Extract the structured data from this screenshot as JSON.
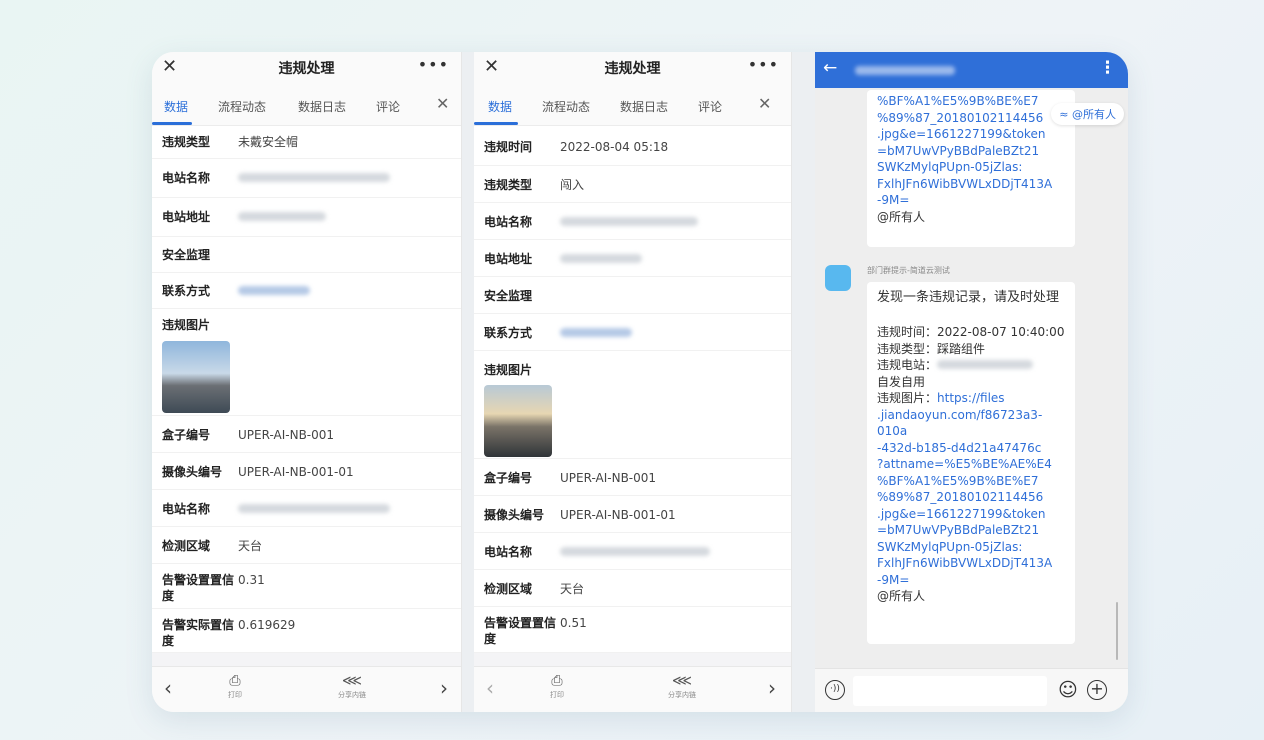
{
  "app": {
    "title": "违规处理",
    "close_glyph": "✕",
    "more_glyph": "•••",
    "tabs": [
      "数据",
      "流程动态",
      "数据日志",
      "评论"
    ],
    "tab_close_glyph": "✕"
  },
  "panel1": {
    "rows": [
      {
        "label": "违规类型",
        "value": "未戴安全帽"
      },
      {
        "label": "电站名称",
        "value": ""
      },
      {
        "label": "电站地址",
        "value": ""
      },
      {
        "label": "安全监理",
        "value": ""
      },
      {
        "label": "联系方式",
        "value": ""
      },
      {
        "label": "违规图片",
        "value": ""
      },
      {
        "label": "盒子编号",
        "value": "UPER-AI-NB-001"
      },
      {
        "label": "摄像头编号",
        "value": "UPER-AI-NB-001-01"
      },
      {
        "label": "电站名称",
        "value": ""
      },
      {
        "label": "检测区域",
        "value": "天台"
      },
      {
        "label": "告警设置置信度",
        "value": "0.31"
      },
      {
        "label": "告警实际置信度",
        "value": "0.619629"
      }
    ]
  },
  "panel2": {
    "rows": [
      {
        "label": "违规时间",
        "value": "2022-08-04 05:18"
      },
      {
        "label": "违规类型",
        "value": "闯入"
      },
      {
        "label": "电站名称",
        "value": ""
      },
      {
        "label": "电站地址",
        "value": ""
      },
      {
        "label": "安全监理",
        "value": ""
      },
      {
        "label": "联系方式",
        "value": ""
      },
      {
        "label": "违规图片",
        "value": ""
      },
      {
        "label": "盒子编号",
        "value": "UPER-AI-NB-001"
      },
      {
        "label": "摄像头编号",
        "value": "UPER-AI-NB-001-01"
      },
      {
        "label": "电站名称",
        "value": ""
      },
      {
        "label": "检测区域",
        "value": "天台"
      },
      {
        "label": "告警设置置信度",
        "value": "0.51"
      }
    ]
  },
  "bottom_bar": {
    "prev_glyph": "‹",
    "next_glyph": "›",
    "print_label": "打印",
    "share_label": "分享内链"
  },
  "chat": {
    "back_glyph": "←",
    "menu_glyph": "⋮",
    "mention_tag": "≈ @所有人",
    "msg1_lines": [
      "%BF%A1%E5%9B%BE%E7",
      "%89%87_20180102114456",
      ".jpg&e=1661227199&token",
      "=bM7UwVPyBBdPaleBZt21",
      "SWKzMylqPUpn-05jZlas:",
      "FxlhJFn6WibBVWLxDDjT413A",
      "-9M="
    ],
    "msg1_mention": "@所有人",
    "bot_name": "部门群提示-简道云测试",
    "msg2_intro": "发现一条违规记录，请及时处理",
    "msg2_time": "违规时间：2022-08-07 10:40:00",
    "msg2_type": "违规类型：踩踏组件",
    "msg2_station_label": "违规电站：",
    "msg2_station_extra": "自发自用",
    "msg2_img_label": "违规图片：",
    "msg2_link_lines": [
      "https://files",
      ".jiandaoyun.com/f86723a3-010a",
      "-432d-b185-d4d21a47476c",
      "?attname=%E5%BE%AE%E4",
      "%BF%A1%E5%9B%BE%E7",
      "%89%87_20180102114456",
      ".jpg&e=1661227199&token",
      "=bM7UwVPyBBdPaleBZt21",
      "SWKzMylqPUpn-05jZlas:",
      "FxlhJFn6WibBVWLxDDjT413A",
      "-9M="
    ],
    "msg2_mention": "@所有人",
    "input_voice": "·))",
    "input_emoji": "☺",
    "input_plus": "+"
  }
}
